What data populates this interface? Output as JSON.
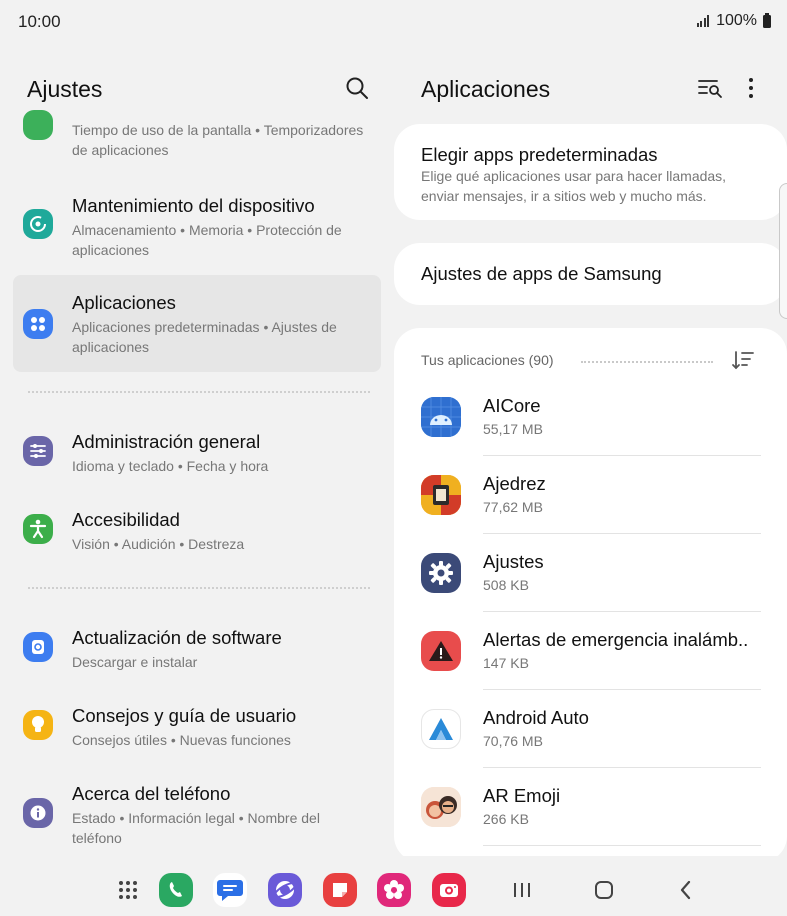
{
  "status_bar": {
    "time": "10:00",
    "battery": "100%"
  },
  "left_pane": {
    "title": "Ajustes",
    "items": [
      {
        "id": "digital-wellbeing",
        "title": "",
        "subtitle": "Tiempo de uso de la pantalla  •  Temporizadores de aplicaciones",
        "icon": "wellbeing-icon",
        "color": "#3cb05a"
      },
      {
        "id": "device-care",
        "title": "Mantenimiento del dispositivo",
        "subtitle": "Almacenamiento  •  Memoria  •  Protección de aplicaciones",
        "icon": "device-care-icon",
        "color": "#1fa99a"
      },
      {
        "id": "apps",
        "title": "Aplicaciones",
        "subtitle": "Aplicaciones predeterminadas  •  Ajustes de aplicaciones",
        "icon": "apps-icon",
        "color": "#3d7df0"
      },
      {
        "id": "general-management",
        "title": "Administración general",
        "subtitle": "Idioma y teclado  •  Fecha y hora",
        "icon": "sliders-icon",
        "color": "#6a66a8"
      },
      {
        "id": "accessibility",
        "title": "Accesibilidad",
        "subtitle": "Visión  •  Audición  •  Destreza",
        "icon": "accessibility-icon",
        "color": "#3cae4a"
      },
      {
        "id": "software-update",
        "title": "Actualización de software",
        "subtitle": "Descargar e instalar",
        "icon": "update-icon",
        "color": "#3d7df0"
      },
      {
        "id": "tips",
        "title": "Consejos y guía de usuario",
        "subtitle": "Consejos útiles  •  Nuevas funciones",
        "icon": "lightbulb-icon",
        "color": "#f5b414"
      },
      {
        "id": "about-phone",
        "title": "Acerca del teléfono",
        "subtitle": "Estado  •  Información legal  •  Nombre del teléfono",
        "icon": "info-icon",
        "color": "#6a66a8"
      }
    ]
  },
  "right_pane": {
    "title": "Aplicaciones",
    "default_apps": {
      "title": "Elegir apps predeterminadas",
      "subtitle": "Elige qué aplicaciones usar para hacer llamadas, enviar mensajes, ir a sitios web y mucho más."
    },
    "samsung_apps": {
      "title": "Ajustes de apps de Samsung"
    },
    "your_apps": {
      "header": "Tus aplicaciones (90)",
      "apps": [
        {
          "name": "AICore",
          "size": "55,17 MB",
          "icon": "android-icon"
        },
        {
          "name": "Ajedrez",
          "size": "77,62 MB",
          "icon": "chess-icon"
        },
        {
          "name": "Ajustes",
          "size": "508 KB",
          "icon": "settings-gear-icon"
        },
        {
          "name": "Alertas de emergencia inalámb..",
          "size": "147 KB",
          "icon": "emergency-alert-icon"
        },
        {
          "name": "Android Auto",
          "size": "70,76 MB",
          "icon": "android-auto-icon"
        },
        {
          "name": "AR Emoji",
          "size": "266 KB",
          "icon": "ar-emoji-icon"
        }
      ]
    }
  },
  "nav_bar": {
    "apps": [
      "app-drawer-icon",
      "phone-icon",
      "messages-icon",
      "internet-icon",
      "notes-icon",
      "gallery-icon",
      "camera-icon"
    ],
    "system": [
      "recents-icon",
      "home-icon",
      "back-icon"
    ]
  },
  "colors": {
    "background": "#f2f2f2",
    "card": "#ffffff",
    "selected": "#e6e6e6",
    "secondary_text": "#777777"
  }
}
